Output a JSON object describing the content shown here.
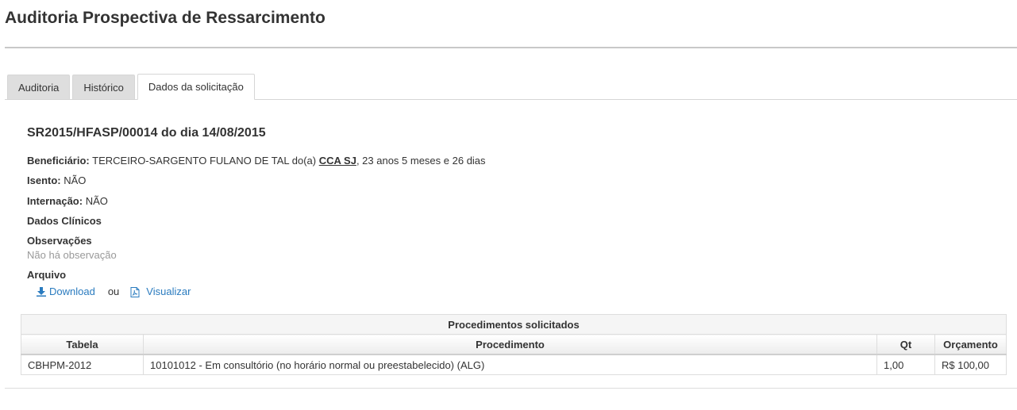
{
  "page": {
    "title": "Auditoria Prospectiva de Ressarcimento"
  },
  "tabs": [
    {
      "label": "Auditoria"
    },
    {
      "label": "Histórico"
    },
    {
      "label": "Dados da solicitação",
      "active": true
    }
  ],
  "request": {
    "heading": "SR2015/HFASP/00014 do dia 14/08/2015",
    "beneficiario_label": "Beneficiário:",
    "beneficiario_value": "TERCEIRO-SARGENTO FULANO DE TAL do(a)",
    "beneficiario_org": "CCA SJ",
    "beneficiario_age": ", 23 anos 5 meses e 26 dias",
    "isento_label": "Isento:",
    "isento_value": "NÃO",
    "internacao_label": "Internação:",
    "internacao_value": "NÃO",
    "dados_clinicos_label": "Dados Clínicos",
    "observacoes_label": "Observações",
    "observacoes_value": "Não há observação",
    "arquivo_label": "Arquivo",
    "download_label": "Download",
    "ou_label": "ou",
    "visualizar_label": "Visualizar"
  },
  "procedures": {
    "caption": "Procedimentos solicitados",
    "columns": [
      "Tabela",
      "Procedimento",
      "Qt",
      "Orçamento"
    ],
    "rows": [
      [
        "CBHPM-2012",
        "10101012 - Em consultório (no horário normal ou preestabelecido) (ALG)",
        "1,00",
        "R$ 100,00"
      ]
    ]
  },
  "colors": {
    "link": "#2a7bbf",
    "muted": "#999999",
    "tab_inactive": "#dedede"
  },
  "icons": {
    "download": "download-icon",
    "visualizar": "pdf-file-icon"
  }
}
